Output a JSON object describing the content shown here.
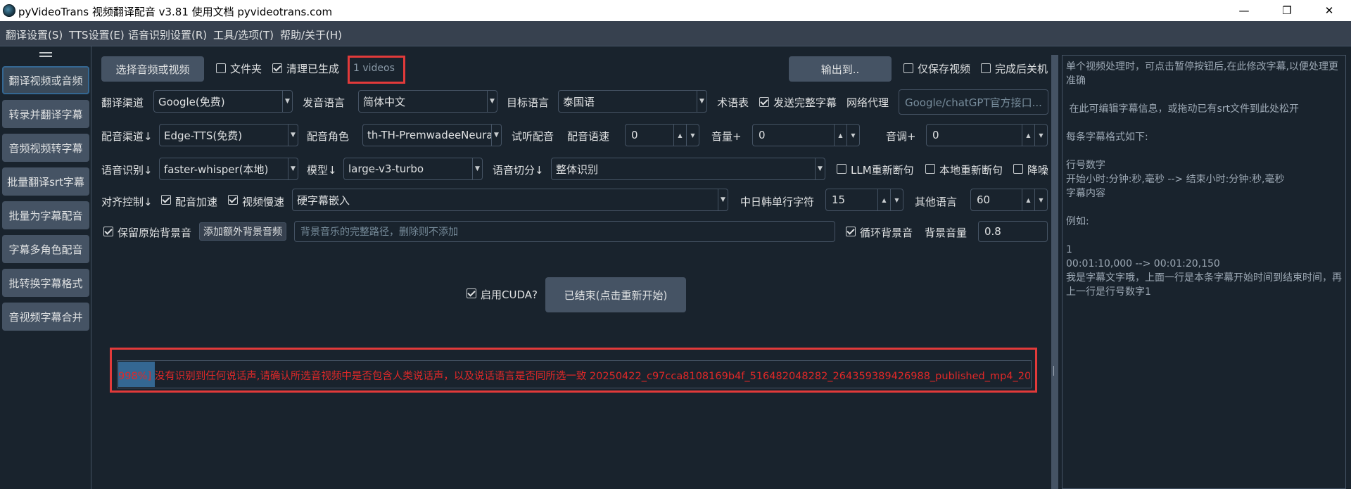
{
  "window": {
    "title": "pyVideoTrans 视频翻译配音 v3.81 使用文档 pyvideotrans.com",
    "controls": {
      "minimize": "—",
      "maximize": "❐",
      "close": "✕"
    }
  },
  "menu": [
    "翻译设置(S)",
    "TTS设置(E)",
    "语音识别设置(R)",
    "工具/选项(T)",
    "帮助/关于(H)"
  ],
  "sidebar": {
    "handle": "=",
    "items": [
      "翻译视频或音频",
      "转录并翻译字幕",
      "音频视频转字幕",
      "批量翻译srt字幕",
      "批量为字幕配音",
      "字幕多角色配音",
      "批转换字幕格式",
      "音视频字幕合并"
    ]
  },
  "row1": {
    "select_button": "选择音频或视频",
    "folder_label": "文件夹",
    "folder_checked": false,
    "clean_label": "清理已生成",
    "clean_checked": true,
    "video_count": "1 videos",
    "output_button": "输出到..",
    "only_video_label": "仅保存视频",
    "only_video_checked": false,
    "shutdown_label": "完成后关机",
    "shutdown_checked": false
  },
  "row2": {
    "channel_label": "翻译渠道",
    "channel_value": "Google(免费)",
    "src_lang_label": "发音语言",
    "src_lang_value": "简体中文",
    "target_lang_label": "目标语言",
    "target_lang_value": "泰国语",
    "glossary_label": "术语表",
    "send_full_label": "发送完整字幕",
    "send_full_checked": true,
    "proxy_label": "网络代理",
    "proxy_placeholder": "Google/chatGPT官方接口..."
  },
  "row3": {
    "tts_label": "配音渠道↓",
    "tts_value": "Edge-TTS(免费)",
    "role_label": "配音角色",
    "role_value": "th-TH-PremwadeeNeural",
    "listen_label": "试听配音",
    "rate_label": "配音语速",
    "rate_value": "0",
    "volume_label": "音量+",
    "volume_value": "0",
    "pitch_label": "音调+",
    "pitch_value": "0"
  },
  "row4": {
    "asr_label": "语音识别↓",
    "asr_value": "faster-whisper(本地)",
    "model_label": "模型↓",
    "model_value": "large-v3-turbo",
    "split_label": "语音切分↓",
    "split_value": "整体识别",
    "llm_label": "LLM重新断句",
    "llm_checked": false,
    "local_label": "本地重新断句",
    "local_checked": false,
    "denoise_label": "降噪",
    "denoise_checked": false
  },
  "row5": {
    "align_label": "对齐控制↓",
    "speedup_label": "配音加速",
    "speedup_checked": true,
    "slowdown_label": "视频慢速",
    "slowdown_checked": true,
    "subtitle_value": "硬字幕嵌入",
    "cjk_label": "中日韩单行字符",
    "cjk_value": "15",
    "other_label": "其他语言",
    "other_value": "60"
  },
  "row6": {
    "keep_bg_label": "保留原始背景音",
    "keep_bg_checked": true,
    "add_bg_button": "添加额外背景音频",
    "bg_path_placeholder": "背景音乐的完整路径，删除则不添加",
    "loop_label": "循环背景音",
    "loop_checked": true,
    "bg_volume_label": "背景音量",
    "bg_volume_value": "0.8"
  },
  "actions": {
    "cuda_label": "启用CUDA?",
    "cuda_checked": true,
    "restart_button": "已结束(点击重新开始)"
  },
  "log": {
    "text": "998%]  没有识别到任何说话声,请确认所选音视频中是否包含人类说话声，以及说话语言是否同所选一致   20250422_c97cca8108169b4f_516482048282_264359389426988_published_mp4_20",
    "color": "#e02828"
  },
  "help_text": "单个视频处理时，可点击暂停按钮后,在此修改字幕,以便处理更准确\n\n 在此可编辑字幕信息，或拖动已有srt文件到此处松开\n\n每条字幕格式如下:\n\n行号数字\n开始小时:分钟:秒,毫秒 --> 结束小时:分钟:秒,毫秒\n字幕内容\n\n例如:\n\n1\n00:01:10,000 --> 00:01:20,150\n我是字幕文字哦，上面一行是本条字幕开始时间到结束时间，再上一行是行号数字1",
  "colors": {
    "background": "#19232d",
    "panel": "#455364",
    "accent": "#346792",
    "highlight_box": "#e23a3a"
  }
}
